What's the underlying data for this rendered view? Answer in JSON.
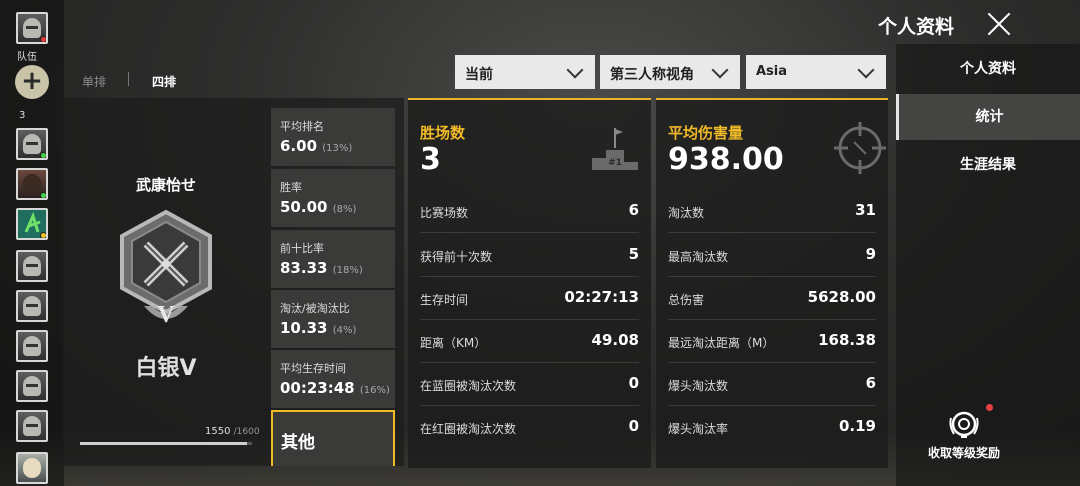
{
  "sidebar": {
    "team_label": "队伍",
    "add_label": "+",
    "member_count": "3",
    "status_colors": {
      "online": "#45d24b",
      "offline": "#e53a3a",
      "away": "#f0c428"
    }
  },
  "modes": {
    "solo": "单排",
    "squad": "四排"
  },
  "filters": {
    "season": "当前",
    "perspective": "第三人称视角",
    "region": "Asia"
  },
  "profile": {
    "player_name": "武康怡せ",
    "rank_name": "白银V",
    "rank_numeral": "V",
    "progress_current": "1550",
    "progress_max": "/1600",
    "progress_fraction": 0.969
  },
  "mini_stats": [
    {
      "label": "平均排名",
      "value": "6.00",
      "pct": "(13%)"
    },
    {
      "label": "胜率",
      "value": "50.00",
      "pct": "(8%)"
    },
    {
      "label": "前十比率",
      "value": "83.33",
      "pct": "(18%)"
    },
    {
      "label": "淘汰/被淘汰比",
      "value": "10.33",
      "pct": "(4%)"
    },
    {
      "label": "平均生存时间",
      "value": "00:23:48",
      "pct": "(16%)"
    }
  ],
  "mini_other": "其他",
  "panel_wins": {
    "title": "胜场数",
    "value": "3",
    "icon_text": "#1",
    "rows": [
      {
        "k": "比赛场数",
        "v": "6"
      },
      {
        "k": "获得前十次数",
        "v": "5"
      },
      {
        "k": "生存时间",
        "v": "02:27:13"
      },
      {
        "k": "距离（KM）",
        "v": "49.08"
      },
      {
        "k": "在蓝圈被淘汰次数",
        "v": "0"
      },
      {
        "k": "在红圈被淘汰次数",
        "v": "0"
      }
    ]
  },
  "panel_damage": {
    "title": "平均伤害量",
    "value": "938.00",
    "rows": [
      {
        "k": "淘汰数",
        "v": "31"
      },
      {
        "k": "最高淘汰数",
        "v": "9"
      },
      {
        "k": "总伤害",
        "v": "5628.00"
      },
      {
        "k": "最远淘汰距离（M）",
        "v": "168.38"
      },
      {
        "k": "爆头淘汰数",
        "v": "6"
      },
      {
        "k": "爆头淘汰率",
        "v": "0.19"
      }
    ]
  },
  "header": {
    "title": "个人资料"
  },
  "right_nav": {
    "profile": "个人资料",
    "stats": "统计",
    "career": "生涯结果"
  },
  "reward": {
    "label": "收取等级奖励"
  },
  "accent_color": "#f0b928"
}
